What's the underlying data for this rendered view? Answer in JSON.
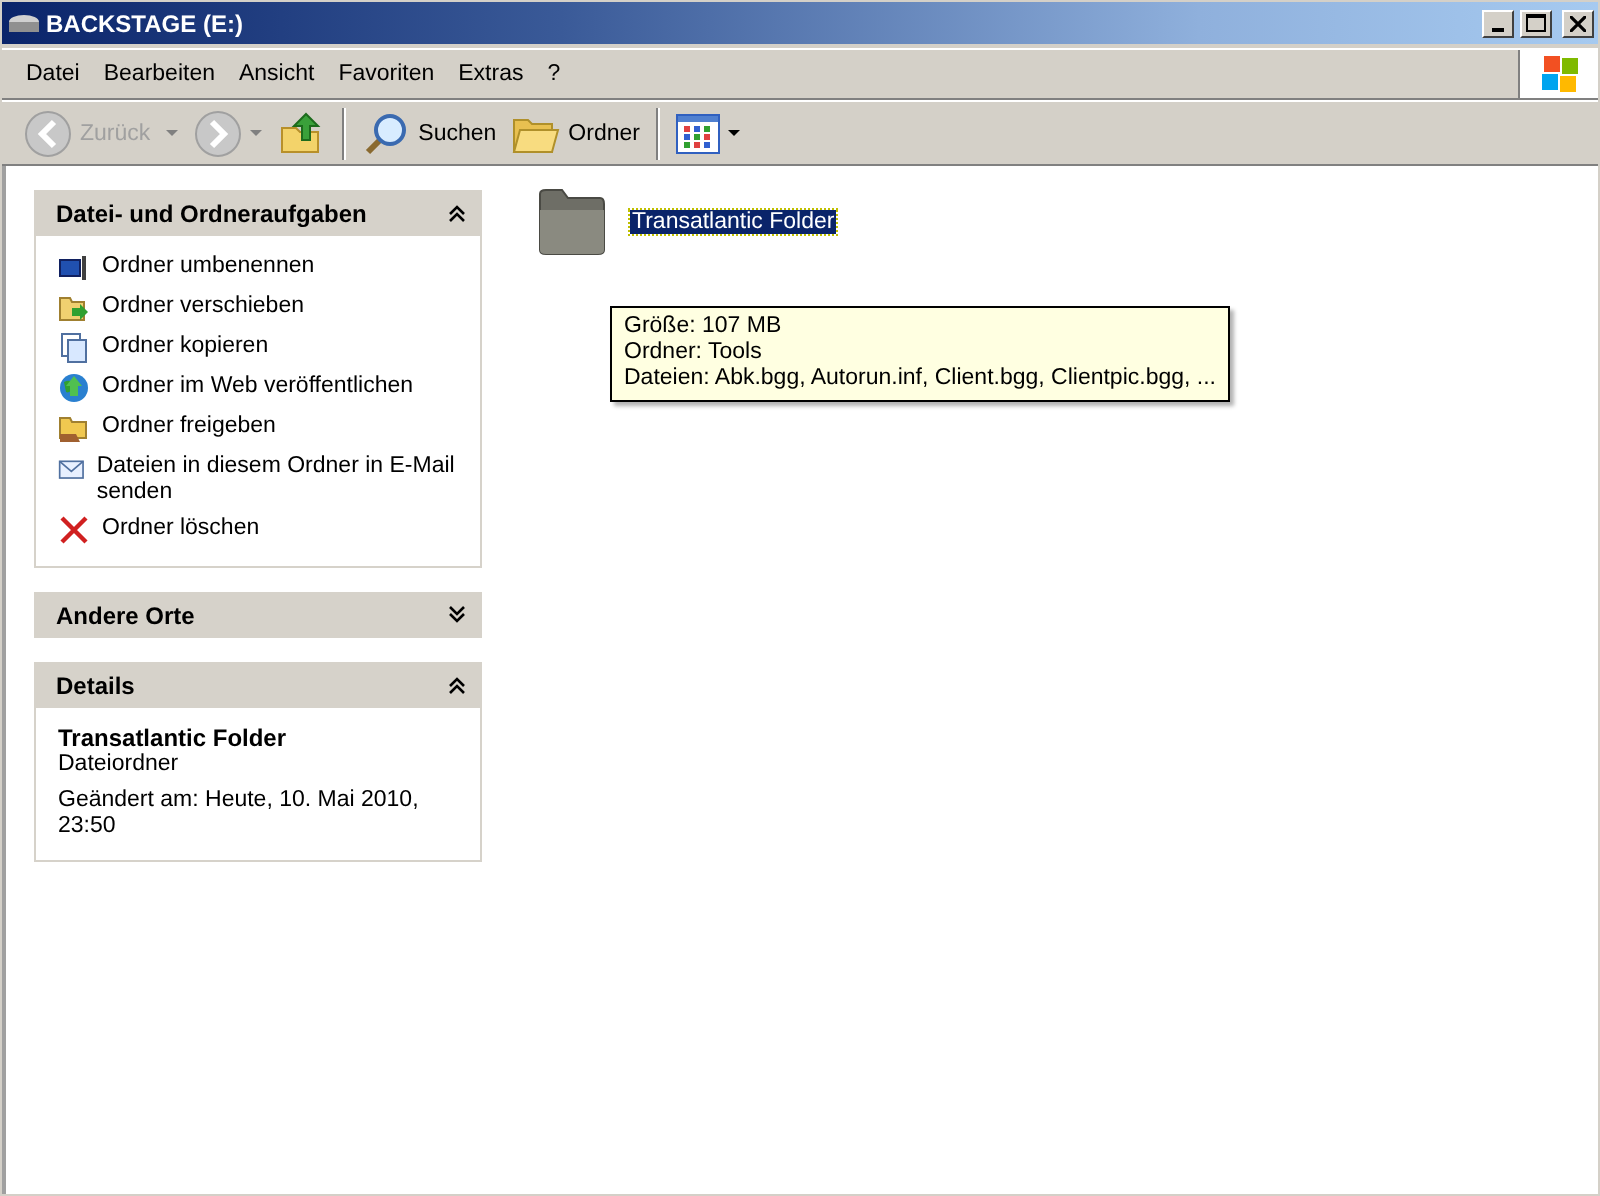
{
  "window": {
    "title": "BACKSTAGE (E:)"
  },
  "menu": [
    "Datei",
    "Bearbeiten",
    "Ansicht",
    "Favoriten",
    "Extras",
    "?"
  ],
  "toolbar": [
    {
      "kind": "back",
      "label": "Zurück",
      "disabled": true
    },
    {
      "kind": "forward",
      "disabled": true
    },
    {
      "kind": "up"
    },
    {
      "kind": "separator"
    },
    {
      "kind": "search",
      "label": "Suchen"
    },
    {
      "kind": "folders",
      "label": "Ordner"
    },
    {
      "kind": "separator"
    },
    {
      "kind": "views"
    }
  ],
  "panels": [
    {
      "kind": "tasks",
      "title": "Datei- und Ordneraufgaben",
      "expanded": true,
      "items": [
        {
          "kind": "rename",
          "label": "Ordner umbenennen"
        },
        {
          "kind": "move",
          "label": "Ordner verschieben"
        },
        {
          "kind": "copy",
          "label": "Ordner kopieren"
        },
        {
          "kind": "web",
          "label": "Ordner im Web veröffentlichen"
        },
        {
          "kind": "share",
          "label": "Ordner freigeben"
        },
        {
          "kind": "email",
          "label": "Dateien in diesem Ordner in E-Mail senden"
        },
        {
          "kind": "delete",
          "label": "Ordner löschen"
        }
      ]
    },
    {
      "title": "Andere Orte",
      "expanded": false
    },
    {
      "kind": "details",
      "title": "Details",
      "expanded": true,
      "name": "Transatlantic Folder",
      "type": "Dateiordner",
      "modified": "Geändert am: Heute, 10. Mai 2010, 23:50"
    }
  ],
  "files": [
    {
      "name": "Transatlantic Folder",
      "selected": true
    }
  ],
  "tooltip": {
    "lines": [
      "Größe: 107 MB",
      "Ordner: Tools",
      "Dateien: Abk.bgg, Autorun.inf, Client.bgg, Clientpic.bgg, ..."
    ]
  }
}
